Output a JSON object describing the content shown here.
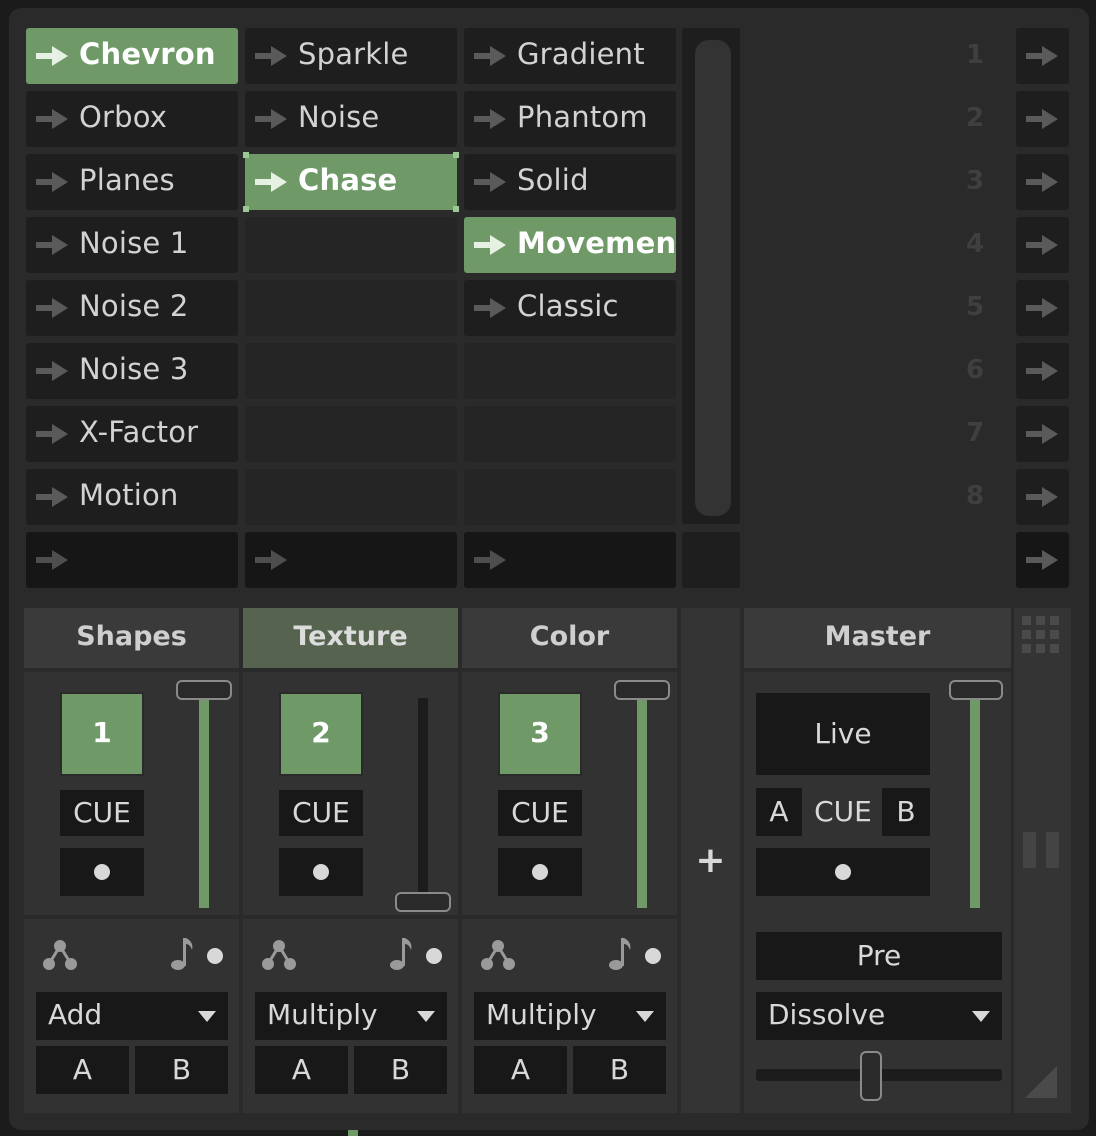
{
  "clips": {
    "col1": [
      "Chevron",
      "Orbox",
      "Planes",
      "Noise 1",
      "Noise 2",
      "Noise 3",
      "X-Factor",
      "Motion"
    ],
    "col2": [
      "Sparkle",
      "Noise",
      "Chase"
    ],
    "col3": [
      "Gradient",
      "Phantom",
      "Solid",
      "Movemen",
      "Classic"
    ],
    "row_numbers": [
      "1",
      "2",
      "3",
      "4",
      "5",
      "6",
      "7",
      "8"
    ]
  },
  "mixer": {
    "layers": [
      {
        "name": "Shapes",
        "number": "1",
        "cue": "CUE",
        "blend": "Add",
        "a": "A",
        "b": "B",
        "level": 1.0
      },
      {
        "name": "Texture",
        "number": "2",
        "cue": "CUE",
        "blend": "Multiply",
        "a": "A",
        "b": "B",
        "level": 0.0
      },
      {
        "name": "Color",
        "number": "3",
        "cue": "CUE",
        "blend": "Multiply",
        "a": "A",
        "b": "B",
        "level": 1.0
      }
    ],
    "add_button": "+",
    "master": {
      "title": "Master",
      "live": "Live",
      "a": "A",
      "cue": "CUE",
      "b": "B",
      "pre": "Pre",
      "transition": "Dissolve",
      "level": 1.0,
      "crossfade": 0.5
    }
  },
  "colors": {
    "accent": "#6f9a68",
    "panel": "#323232",
    "background": "#2a2a2a"
  },
  "icons": {
    "clip_launch": "arrow-right-icon",
    "source": "tree-icon",
    "audio": "music-note-icon",
    "grip": "grid-dots-icon"
  }
}
